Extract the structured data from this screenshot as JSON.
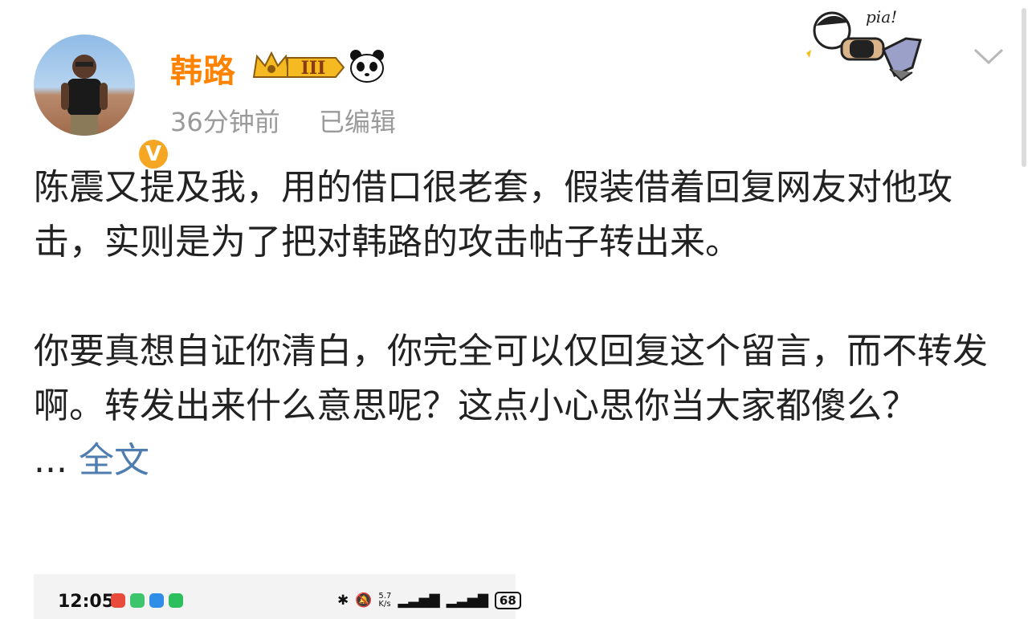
{
  "post": {
    "username": "韩路",
    "vip_level": "III",
    "verified_badge": "V",
    "time_ago": "36分钟前",
    "edited_label": "已编辑",
    "sticker_text": "pia!",
    "paragraphs": [
      "陈震又提及我，用的借口很老套，假装借着回复网友对他攻击，实则是为了把对韩路的攻击帖子转出来。",
      "你要真想自证你清白，你完全可以仅回复这个留言，而不转发啊。转发出来什么意思呢？这点小心思你当大家都傻么？"
    ],
    "ellipsis": "...",
    "more_link": "全文"
  },
  "embedded_screenshot": {
    "time": "12:05",
    "speed_top": "5.7",
    "speed_bottom": "K/s",
    "battery": "68"
  },
  "colors": {
    "username": "#ff8200",
    "link": "#507daf",
    "meta": "#9a9a9a",
    "vip_gold": "#f5b921"
  },
  "icons": [
    "verified-v-icon",
    "vip-crown-icon",
    "panda-icon",
    "pia-sticker-icon",
    "chevron-down-icon"
  ]
}
